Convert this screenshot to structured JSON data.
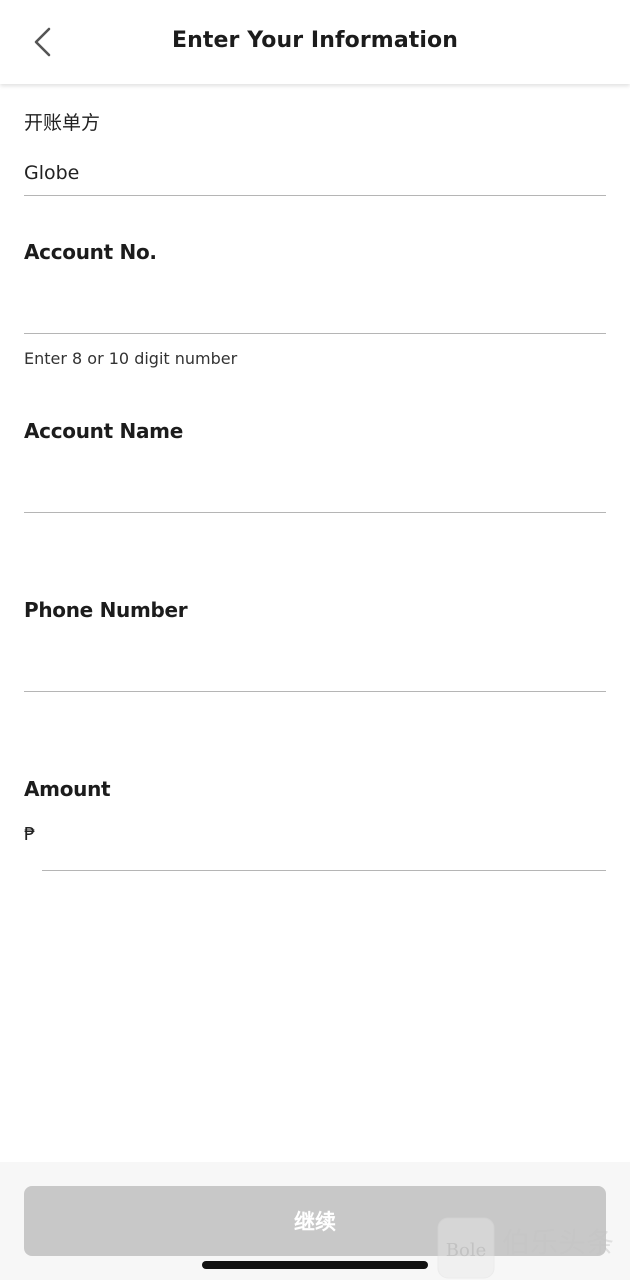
{
  "header": {
    "title": "Enter Your Information",
    "back_icon": "chevron-left-icon"
  },
  "form": {
    "biller": {
      "label": "开账单方",
      "value": "Globe"
    },
    "account_no": {
      "label": "Account No.",
      "value": "",
      "helper": "Enter 8 or 10 digit number"
    },
    "account_name": {
      "label": "Account Name",
      "value": ""
    },
    "phone_number": {
      "label": "Phone Number",
      "value": ""
    },
    "amount": {
      "label": "Amount",
      "currency_symbol": "₱",
      "value": ""
    }
  },
  "footer": {
    "continue_label": "继续"
  },
  "watermark": {
    "text_latin": "Bole",
    "text_cn": "伯乐头条"
  },
  "colors": {
    "button_disabled": "#c8c8c8",
    "divider": "#b5b5b5",
    "text_primary": "#1c1c1c"
  }
}
